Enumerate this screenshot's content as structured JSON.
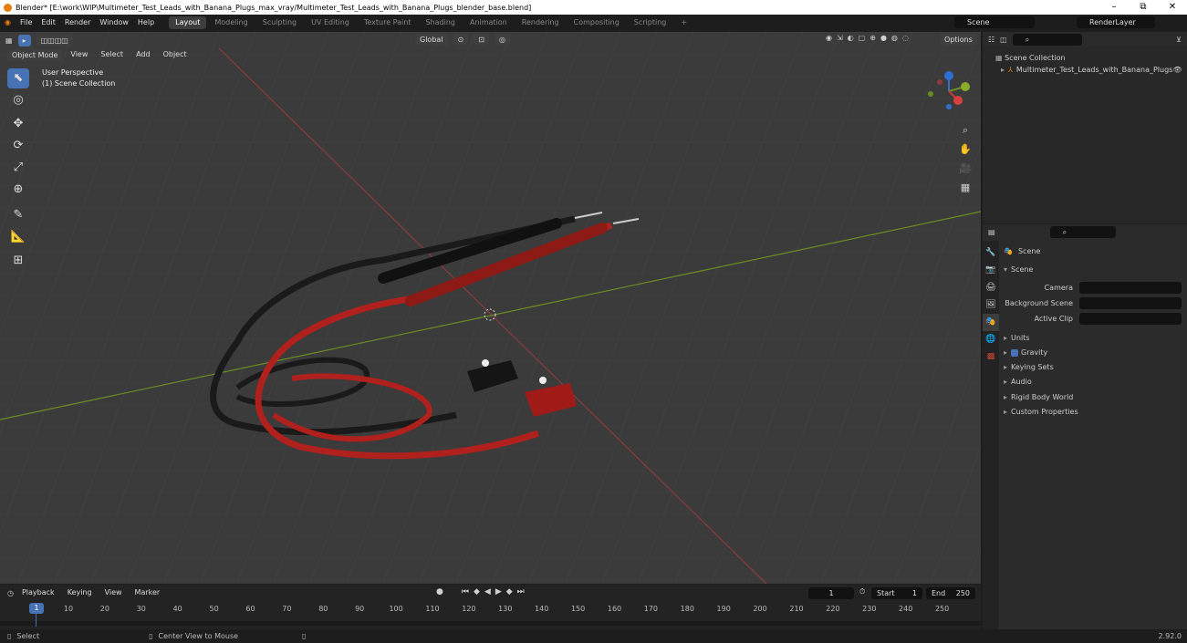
{
  "title": "Blender* [E:\\work\\WIP\\Multimeter_Test_Leads_with_Banana_Plugs_max_vray/Multimeter_Test_Leads_with_Banana_Plugs_blender_base.blend]",
  "window_controls": {
    "min": "–",
    "max": "⧉",
    "close": "✕"
  },
  "menu": [
    "File",
    "Edit",
    "Render",
    "Window",
    "Help"
  ],
  "workspaces": [
    "Layout",
    "Modeling",
    "Sculpting",
    "UV Editing",
    "Texture Paint",
    "Shading",
    "Animation",
    "Rendering",
    "Compositing",
    "Scripting"
  ],
  "scene_name": "Scene",
  "view_layer": "RenderLayer",
  "viewport": {
    "mode": "Object Mode",
    "menus": [
      "View",
      "Select",
      "Add",
      "Object"
    ],
    "orientation": "Global",
    "options": "Options",
    "overlay_line1": "User Perspective",
    "overlay_line2": "(1) Scene Collection"
  },
  "outliner": {
    "root": "Scene Collection",
    "item": "Multimeter_Test_Leads_with_Banana_Plugs"
  },
  "properties": {
    "header": "Scene",
    "panel": "Scene",
    "camera_label": "Camera",
    "background_label": "Background Scene",
    "clip_label": "Active Clip",
    "sections": [
      "Units",
      "Gravity",
      "Keying Sets",
      "Audio",
      "Rigid Body World",
      "Custom Properties"
    ]
  },
  "timeline": {
    "menus": [
      "Playback",
      "Keying",
      "View",
      "Marker"
    ],
    "current_frame": "1",
    "start_label": "Start",
    "start": "1",
    "end_label": "End",
    "end": "250",
    "ticks": [
      "10",
      "20",
      "30",
      "40",
      "50",
      "60",
      "70",
      "80",
      "90",
      "100",
      "110",
      "120",
      "130",
      "140",
      "150",
      "160",
      "170",
      "180",
      "190",
      "200",
      "210",
      "220",
      "230",
      "240",
      "250"
    ],
    "cursor": "1"
  },
  "status": {
    "select": "Select",
    "center": "Center View to Mouse",
    "version": "2.92.0"
  },
  "colors": {
    "accent": "#4772b3",
    "x_axis": "#8c3b3b",
    "y_axis": "#6b8e23",
    "lead_red": "#b0201c",
    "lead_black": "#1a1a1a"
  }
}
